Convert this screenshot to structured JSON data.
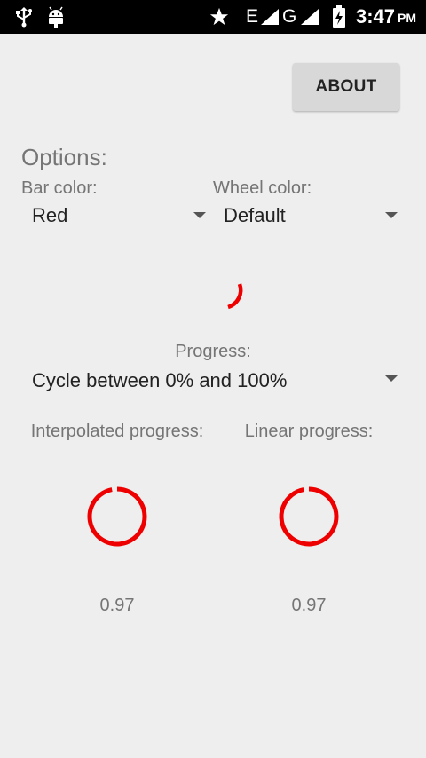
{
  "status_bar": {
    "time": "3:47",
    "ampm": "PM",
    "network_label_1": "E",
    "network_label_2": "G"
  },
  "about_button": {
    "label": "ABOUT"
  },
  "options": {
    "heading": "Options:",
    "bar_color_label": "Bar color:",
    "bar_color_value": "Red",
    "wheel_color_label": "Wheel color:",
    "wheel_color_value": "Default"
  },
  "progress": {
    "label": "Progress:",
    "mode_value": "Cycle between 0% and 100%"
  },
  "indicators": {
    "interpolated_label": "Interpolated progress:",
    "linear_label": "Linear progress:",
    "interpolated_value": "0.97",
    "linear_value": "0.97",
    "interpolated_fraction": 0.97,
    "linear_fraction": 0.97
  },
  "colors": {
    "bar": "#ee0000",
    "background": "#eeeeee"
  },
  "icons": [
    "usb-icon",
    "android-debug-icon",
    "star-icon",
    "signal-icon",
    "battery-charging-icon"
  ]
}
